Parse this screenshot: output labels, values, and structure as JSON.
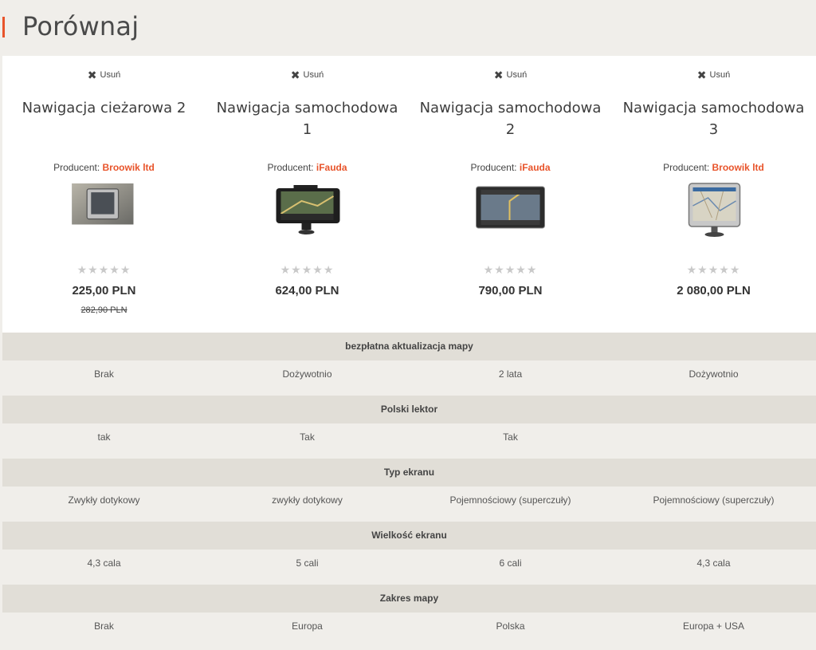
{
  "header": {
    "title": "Porównaj"
  },
  "products": [
    {
      "remove_label": "Usuń",
      "name": "Nawigacja cieżarowa 2",
      "producer_label": "Producent:",
      "producer": "Broowik ltd",
      "rating": "★★★★★",
      "price": "225,00 PLN",
      "old_price": "282,90 PLN"
    },
    {
      "remove_label": "Usuń",
      "name": "Nawigacja samochodowa 1",
      "producer_label": "Producent:",
      "producer": "iFauda",
      "rating": "★★★★★",
      "price": "624,00 PLN",
      "old_price": ""
    },
    {
      "remove_label": "Usuń",
      "name": "Nawigacja samochodowa 2",
      "producer_label": "Producent:",
      "producer": "iFauda",
      "rating": "★★★★★",
      "price": "790,00 PLN",
      "old_price": ""
    },
    {
      "remove_label": "Usuń",
      "name": "Nawigacja samochodowa 3",
      "producer_label": "Producent:",
      "producer": "Broowik ltd",
      "rating": "★★★★★",
      "price": "2 080,00 PLN",
      "old_price": ""
    }
  ],
  "features": [
    {
      "name": "bezpłatna aktualizacja mapy",
      "values": [
        "Brak",
        "Dożywotnio",
        "2 lata",
        "Dożywotnio"
      ]
    },
    {
      "name": "Polski lektor",
      "values": [
        "tak",
        "Tak",
        "Tak",
        ""
      ]
    },
    {
      "name": "Typ ekranu",
      "values": [
        "Zwykły dotykowy",
        "zwykły dotykowy",
        "Pojemnościowy (superczuły)",
        "Pojemnościowy (superczuły)"
      ]
    },
    {
      "name": "Wielkość ekranu",
      "values": [
        "4,3 cala",
        "5 cali",
        "6 cali",
        "4,3 cala"
      ]
    },
    {
      "name": "Zakres mapy",
      "values": [
        "Brak",
        "Europa",
        "Polska",
        "Europa + USA"
      ]
    }
  ]
}
